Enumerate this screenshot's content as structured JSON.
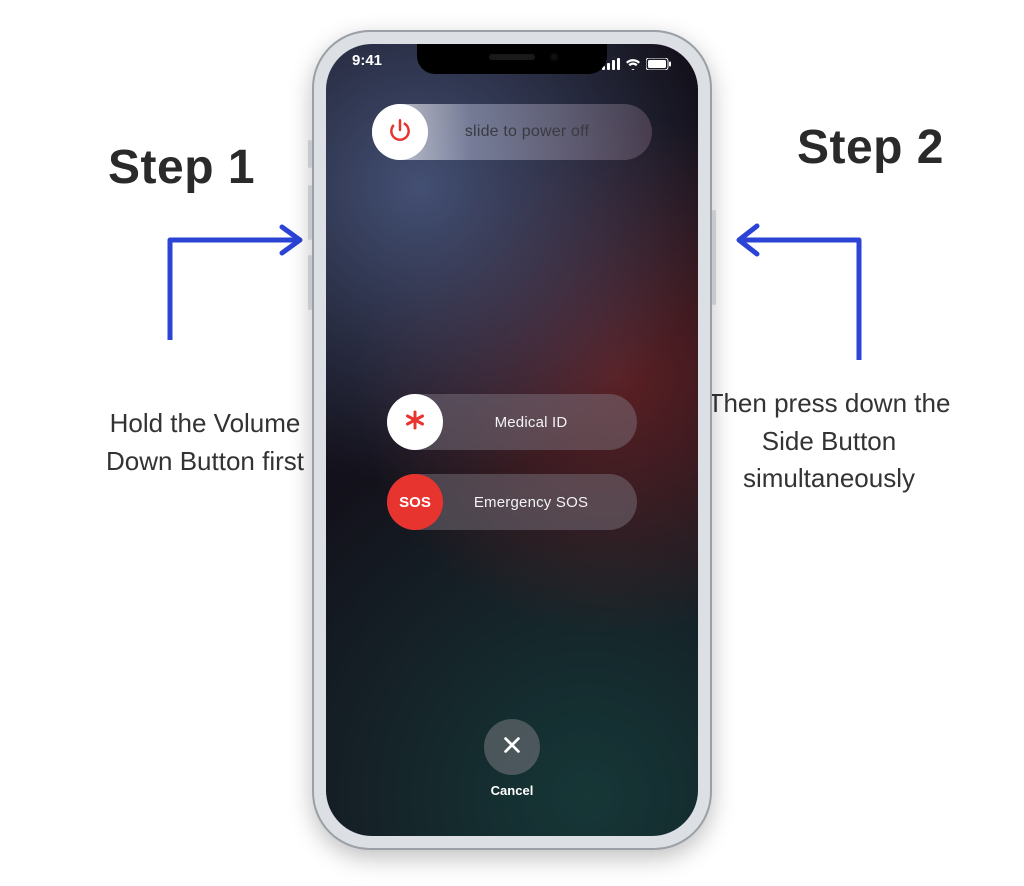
{
  "annotations": {
    "left": {
      "title": "Step 1",
      "text": "Hold the Volume Down Button first"
    },
    "right": {
      "title": "Step 2",
      "text": "Then press down the Side Button simultaneously"
    }
  },
  "status": {
    "time": "9:41"
  },
  "sliders": {
    "power_off": "slide to power off",
    "medical_id": "Medical ID",
    "sos_knob": "SOS",
    "emergency_sos": "Emergency SOS"
  },
  "cancel": {
    "label": "Cancel"
  }
}
